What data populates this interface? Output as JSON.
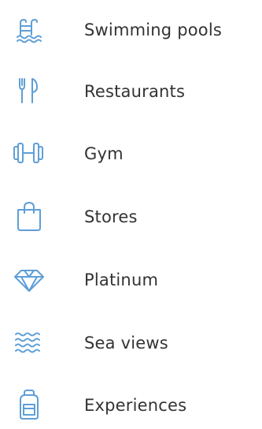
{
  "theme": {
    "icon_color": "#5e9fd6",
    "text_color": "#333333"
  },
  "amenities": [
    {
      "icon": "swimming-pool-icon",
      "label": "Swimming pools"
    },
    {
      "icon": "restaurant-icon",
      "label": "Restaurants"
    },
    {
      "icon": "gym-icon",
      "label": "Gym"
    },
    {
      "icon": "shopping-bag-icon",
      "label": "Stores"
    },
    {
      "icon": "diamond-icon",
      "label": "Platinum"
    },
    {
      "icon": "waves-icon",
      "label": "Sea views"
    },
    {
      "icon": "backpack-icon",
      "label": "Experiences"
    }
  ]
}
